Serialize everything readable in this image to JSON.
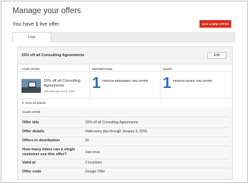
{
  "page": {
    "title": "Manage your offers",
    "live_prefix": "You have ",
    "live_count": "1",
    "live_suffix": " live offer.",
    "add_button": "ADD A NEW OFFER"
  },
  "tabs": [
    {
      "label": "Live"
    }
  ],
  "offer": {
    "header_title": "15% off all Consulting Agreements",
    "edit_label": "Edit",
    "columns": {
      "your_offer": "YOUR OFFER",
      "redemptions": "REDEMPTIONS",
      "saved": "SAVED"
    },
    "name": "15% off all Consulting Agreements",
    "valid_through": "Valid through Jan 5, 2015",
    "redemptions_count": "1",
    "redemptions_label": "PERSON REDEEMED THIS OFFER",
    "saved_count": "1",
    "saved_label": "PERSON SAVED THIS OFFER",
    "view_all": "View all details"
  },
  "details": {
    "section_label": "YOUR OFFER",
    "rows": [
      {
        "label": "Offer title",
        "value": "15% off all Consulting Agreements"
      },
      {
        "label": "Offer details",
        "value": "Valid every day through January 5, 2015."
      },
      {
        "label": "Offers in distribution",
        "value": "50"
      },
      {
        "label": "How many times can a single customer use this offer?",
        "value": "Just once"
      },
      {
        "label": "Valid at",
        "value": "2 locations"
      },
      {
        "label": "Offer code",
        "value": "Google Offer"
      }
    ]
  },
  "colors": {
    "accent_red": "#d7301f",
    "number_blue": "#2a6fc0"
  },
  "icons": {
    "expand": "chevron-down-icon"
  }
}
